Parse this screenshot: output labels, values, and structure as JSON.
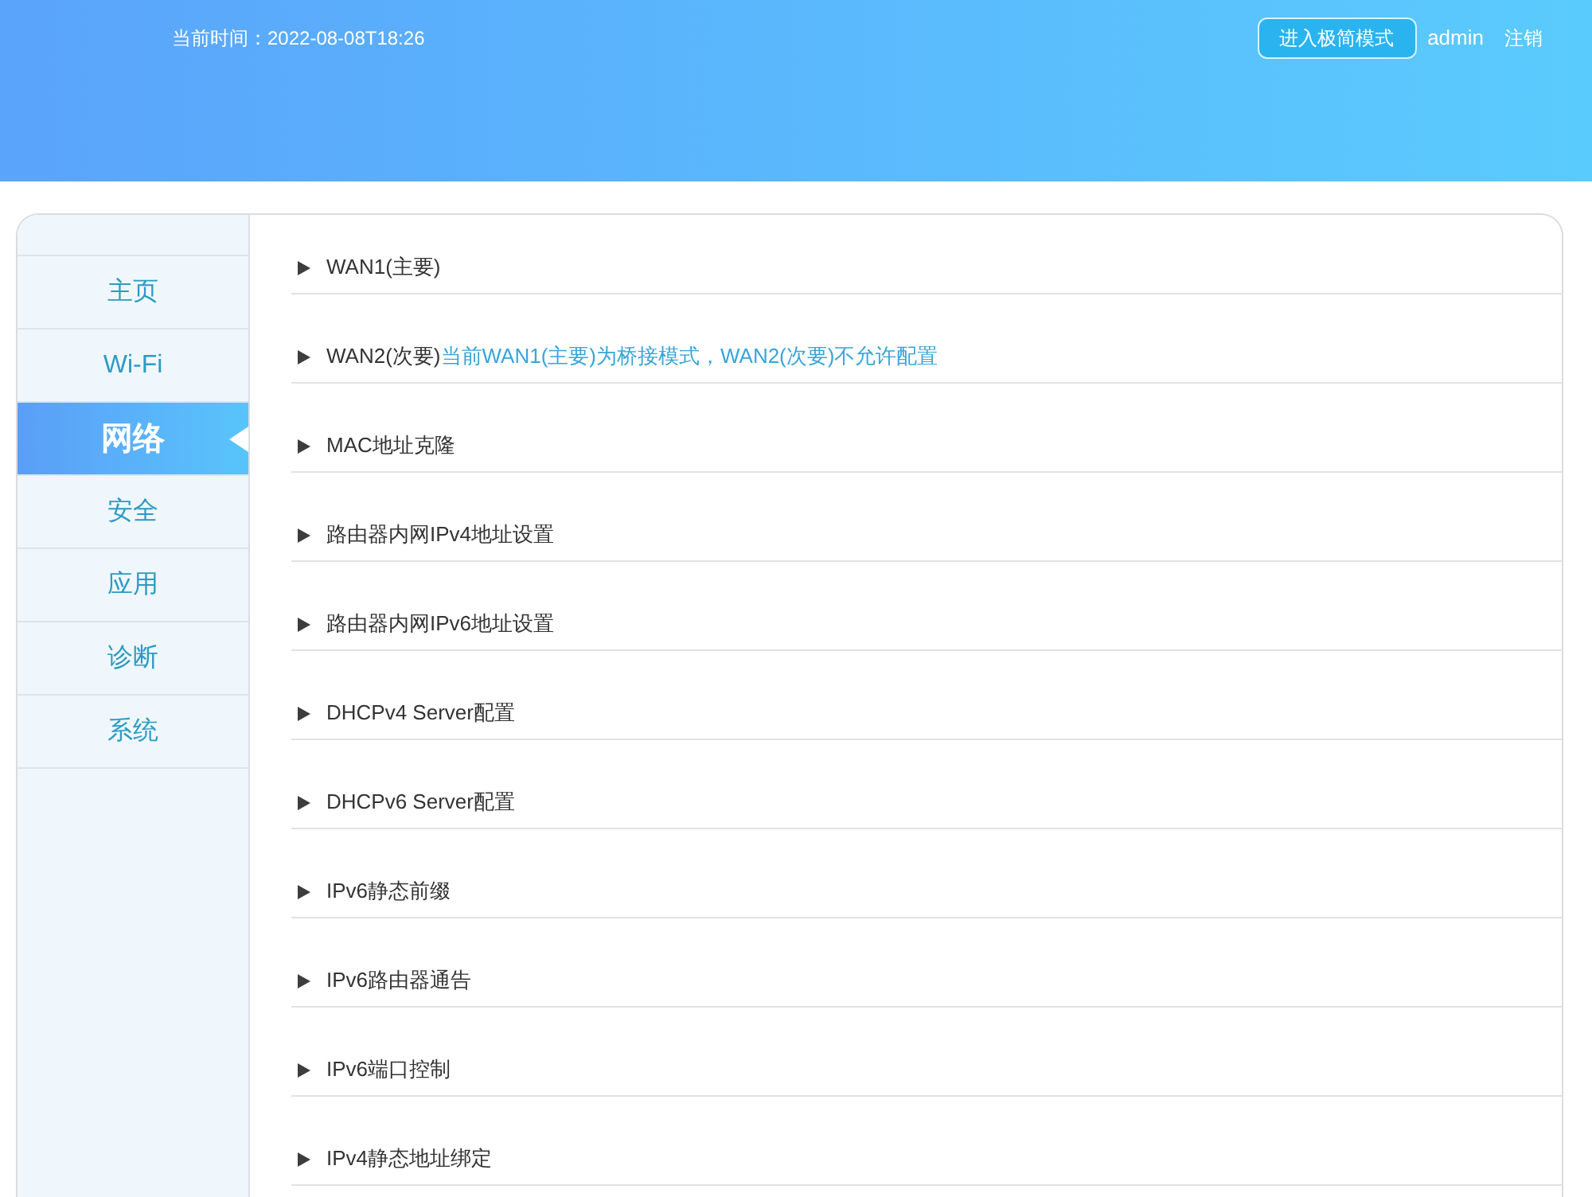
{
  "header": {
    "clock": "当前时间：2022-08-08T18:26",
    "mode_button": "进入极简模式",
    "user": "admin",
    "logout": "注销"
  },
  "sidebar": {
    "items": [
      {
        "label": "主页",
        "selected": false
      },
      {
        "label": "Wi-Fi",
        "selected": false
      },
      {
        "label": "网络",
        "selected": true
      },
      {
        "label": "安全",
        "selected": false
      },
      {
        "label": "应用",
        "selected": false
      },
      {
        "label": "诊断",
        "selected": false
      },
      {
        "label": "系统",
        "selected": false
      }
    ]
  },
  "sections": [
    {
      "title": "WAN1(主要)",
      "expanded": false
    },
    {
      "title": "WAN2(次要)",
      "note": "当前WAN1(主要)为桥接模式，WAN2(次要)不允许配置",
      "expanded": false
    },
    {
      "title": "MAC地址克隆",
      "expanded": false
    },
    {
      "title": "路由器内网IPv4地址设置",
      "expanded": false
    },
    {
      "title": "路由器内网IPv6地址设置",
      "expanded": false
    },
    {
      "title": "DHCPv4 Server配置",
      "expanded": false
    },
    {
      "title": "DHCPv6 Server配置",
      "expanded": false
    },
    {
      "title": "IPv6静态前缀",
      "expanded": false
    },
    {
      "title": "IPv6路由器通告",
      "expanded": false
    },
    {
      "title": "IPv6端口控制",
      "expanded": false
    },
    {
      "title": "IPv4静态地址绑定",
      "expanded": false
    }
  ]
}
